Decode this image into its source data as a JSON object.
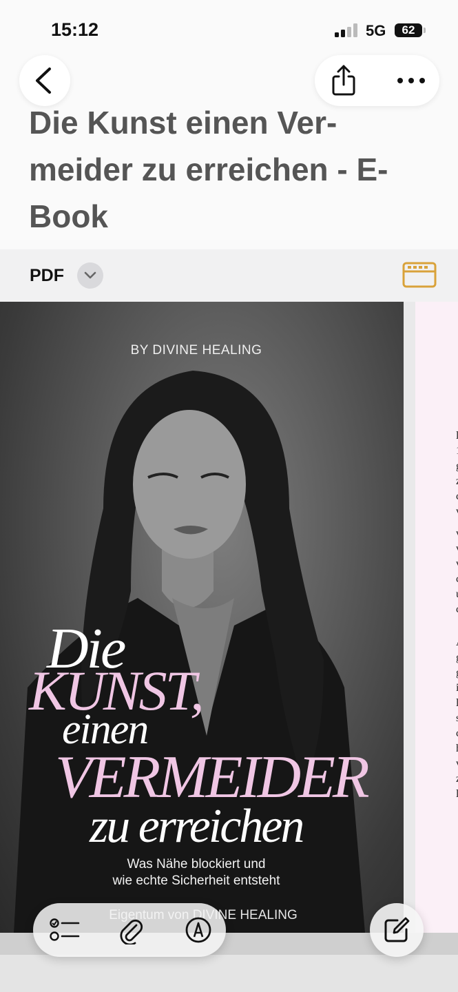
{
  "status_bar": {
    "time": "15:12",
    "network": "5G",
    "battery": "62"
  },
  "header": {
    "title": "Die Kunst einen Ver-meider zu erreichen - E-Book",
    "icons": {
      "back": "chevron-left-icon",
      "share": "share-icon",
      "more": "ellipsis-icon"
    }
  },
  "pdf_bar": {
    "label": "PDF",
    "icons": {
      "dropdown": "chevron-down-icon",
      "view": "page-view-icon"
    },
    "accent": "#d9a23a"
  },
  "cover": {
    "byline": "BY DIVINE HEALING",
    "title_lines": [
      "Die",
      "KUNST,",
      "einen",
      "VERMEIDER",
      "zu erreichen"
    ],
    "subtitle_lines": [
      "Was Nähe blockiert und",
      "wie echte Sicherheit entsteht"
    ],
    "credit": "Eigentum von DIVINE HEALING",
    "accent_color": "#f0c6e4"
  },
  "toolbar": {
    "icons": [
      "checklist-icon",
      "paperclip-icon",
      "markup-pen-icon"
    ],
    "compose_icon": "compose-icon"
  }
}
